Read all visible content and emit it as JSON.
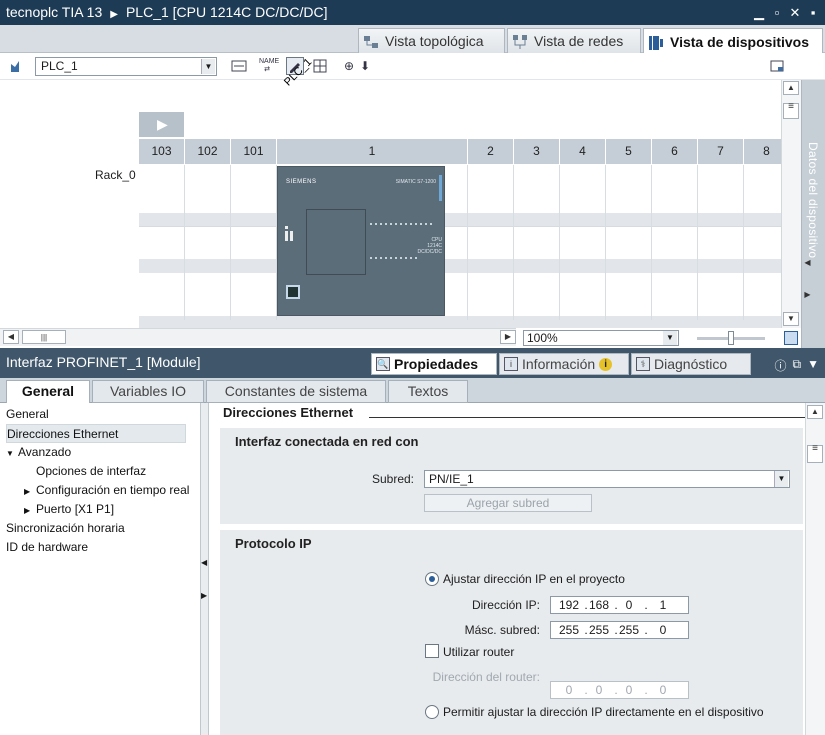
{
  "title": {
    "project": "tecnoplc TIA 13",
    "device": "PLC_1 [CPU 1214C DC/DC/DC]"
  },
  "window_icons": [
    "minimize-icon",
    "restore-icon",
    "close-icon",
    "float-icon"
  ],
  "view_tabs": [
    {
      "label": "Vista topológica",
      "active": false
    },
    {
      "label": "Vista de redes",
      "active": false
    },
    {
      "label": "Vista de dispositivos",
      "active": true
    }
  ],
  "toolbar": {
    "device_select": "PLC_1",
    "zoom": "100%"
  },
  "canvas": {
    "plc_tag": "PLC_1",
    "rack_label": "Rack_0",
    "slots": [
      "103",
      "102",
      "101",
      "1",
      "2",
      "3",
      "4",
      "5",
      "6",
      "7",
      "8"
    ],
    "cpu_brand": "SIEMENS",
    "cpu_model": "SIMATIC S7-1200",
    "cpu_type": "CPU 1214C DC/DC/DC"
  },
  "side_tab": "Datos del dispositivo",
  "inspector": {
    "title": "Interfaz PROFINET_1 [Module]",
    "tabs": [
      {
        "label": "Propiedades",
        "active": true
      },
      {
        "label": "Información",
        "active": false
      },
      {
        "label": "Diagnóstico",
        "active": false
      }
    ],
    "general_tabs": [
      {
        "label": "General",
        "active": true
      },
      {
        "label": "Variables IO",
        "active": false
      },
      {
        "label": "Constantes de sistema",
        "active": false
      },
      {
        "label": "Textos",
        "active": false
      }
    ]
  },
  "nav": [
    {
      "label": "General",
      "indent": 0,
      "expander": "",
      "selected": false
    },
    {
      "label": "Direcciones Ethernet",
      "indent": 0,
      "expander": "",
      "selected": true
    },
    {
      "label": "Avanzado",
      "indent": 0,
      "expander": "▼",
      "selected": false
    },
    {
      "label": "Opciones de interfaz",
      "indent": 1,
      "expander": "",
      "selected": false
    },
    {
      "label": "Configuración en tiempo real",
      "indent": 1,
      "expander": "▶",
      "selected": false
    },
    {
      "label": "Puerto [X1 P1]",
      "indent": 1,
      "expander": "▶",
      "selected": false
    },
    {
      "label": "Sincronización horaria",
      "indent": 0,
      "expander": "",
      "selected": false
    },
    {
      "label": "ID de hardware",
      "indent": 0,
      "expander": "",
      "selected": false
    }
  ],
  "content": {
    "section_title": "Direcciones Ethernet",
    "network": {
      "heading": "Interfaz conectada en red con",
      "subnet_label": "Subred:",
      "subnet_value": "PN/IE_1",
      "add_subnet": "Agregar subred"
    },
    "ip": {
      "heading": "Protocolo IP",
      "opt_project": "Ajustar dirección IP en el proyecto",
      "ip_label": "Dirección IP:",
      "ip_octets": [
        "192",
        "168",
        "0",
        "1"
      ],
      "mask_label": "Másc. subred:",
      "mask_octets": [
        "255",
        "255",
        "255",
        "0"
      ],
      "router_check": "Utilizar router",
      "router_label": "Dirección del router:",
      "router_octets": [
        "0",
        "0",
        "0",
        "0"
      ],
      "opt_device": "Permitir ajustar la dirección IP directamente en el dispositivo"
    }
  }
}
